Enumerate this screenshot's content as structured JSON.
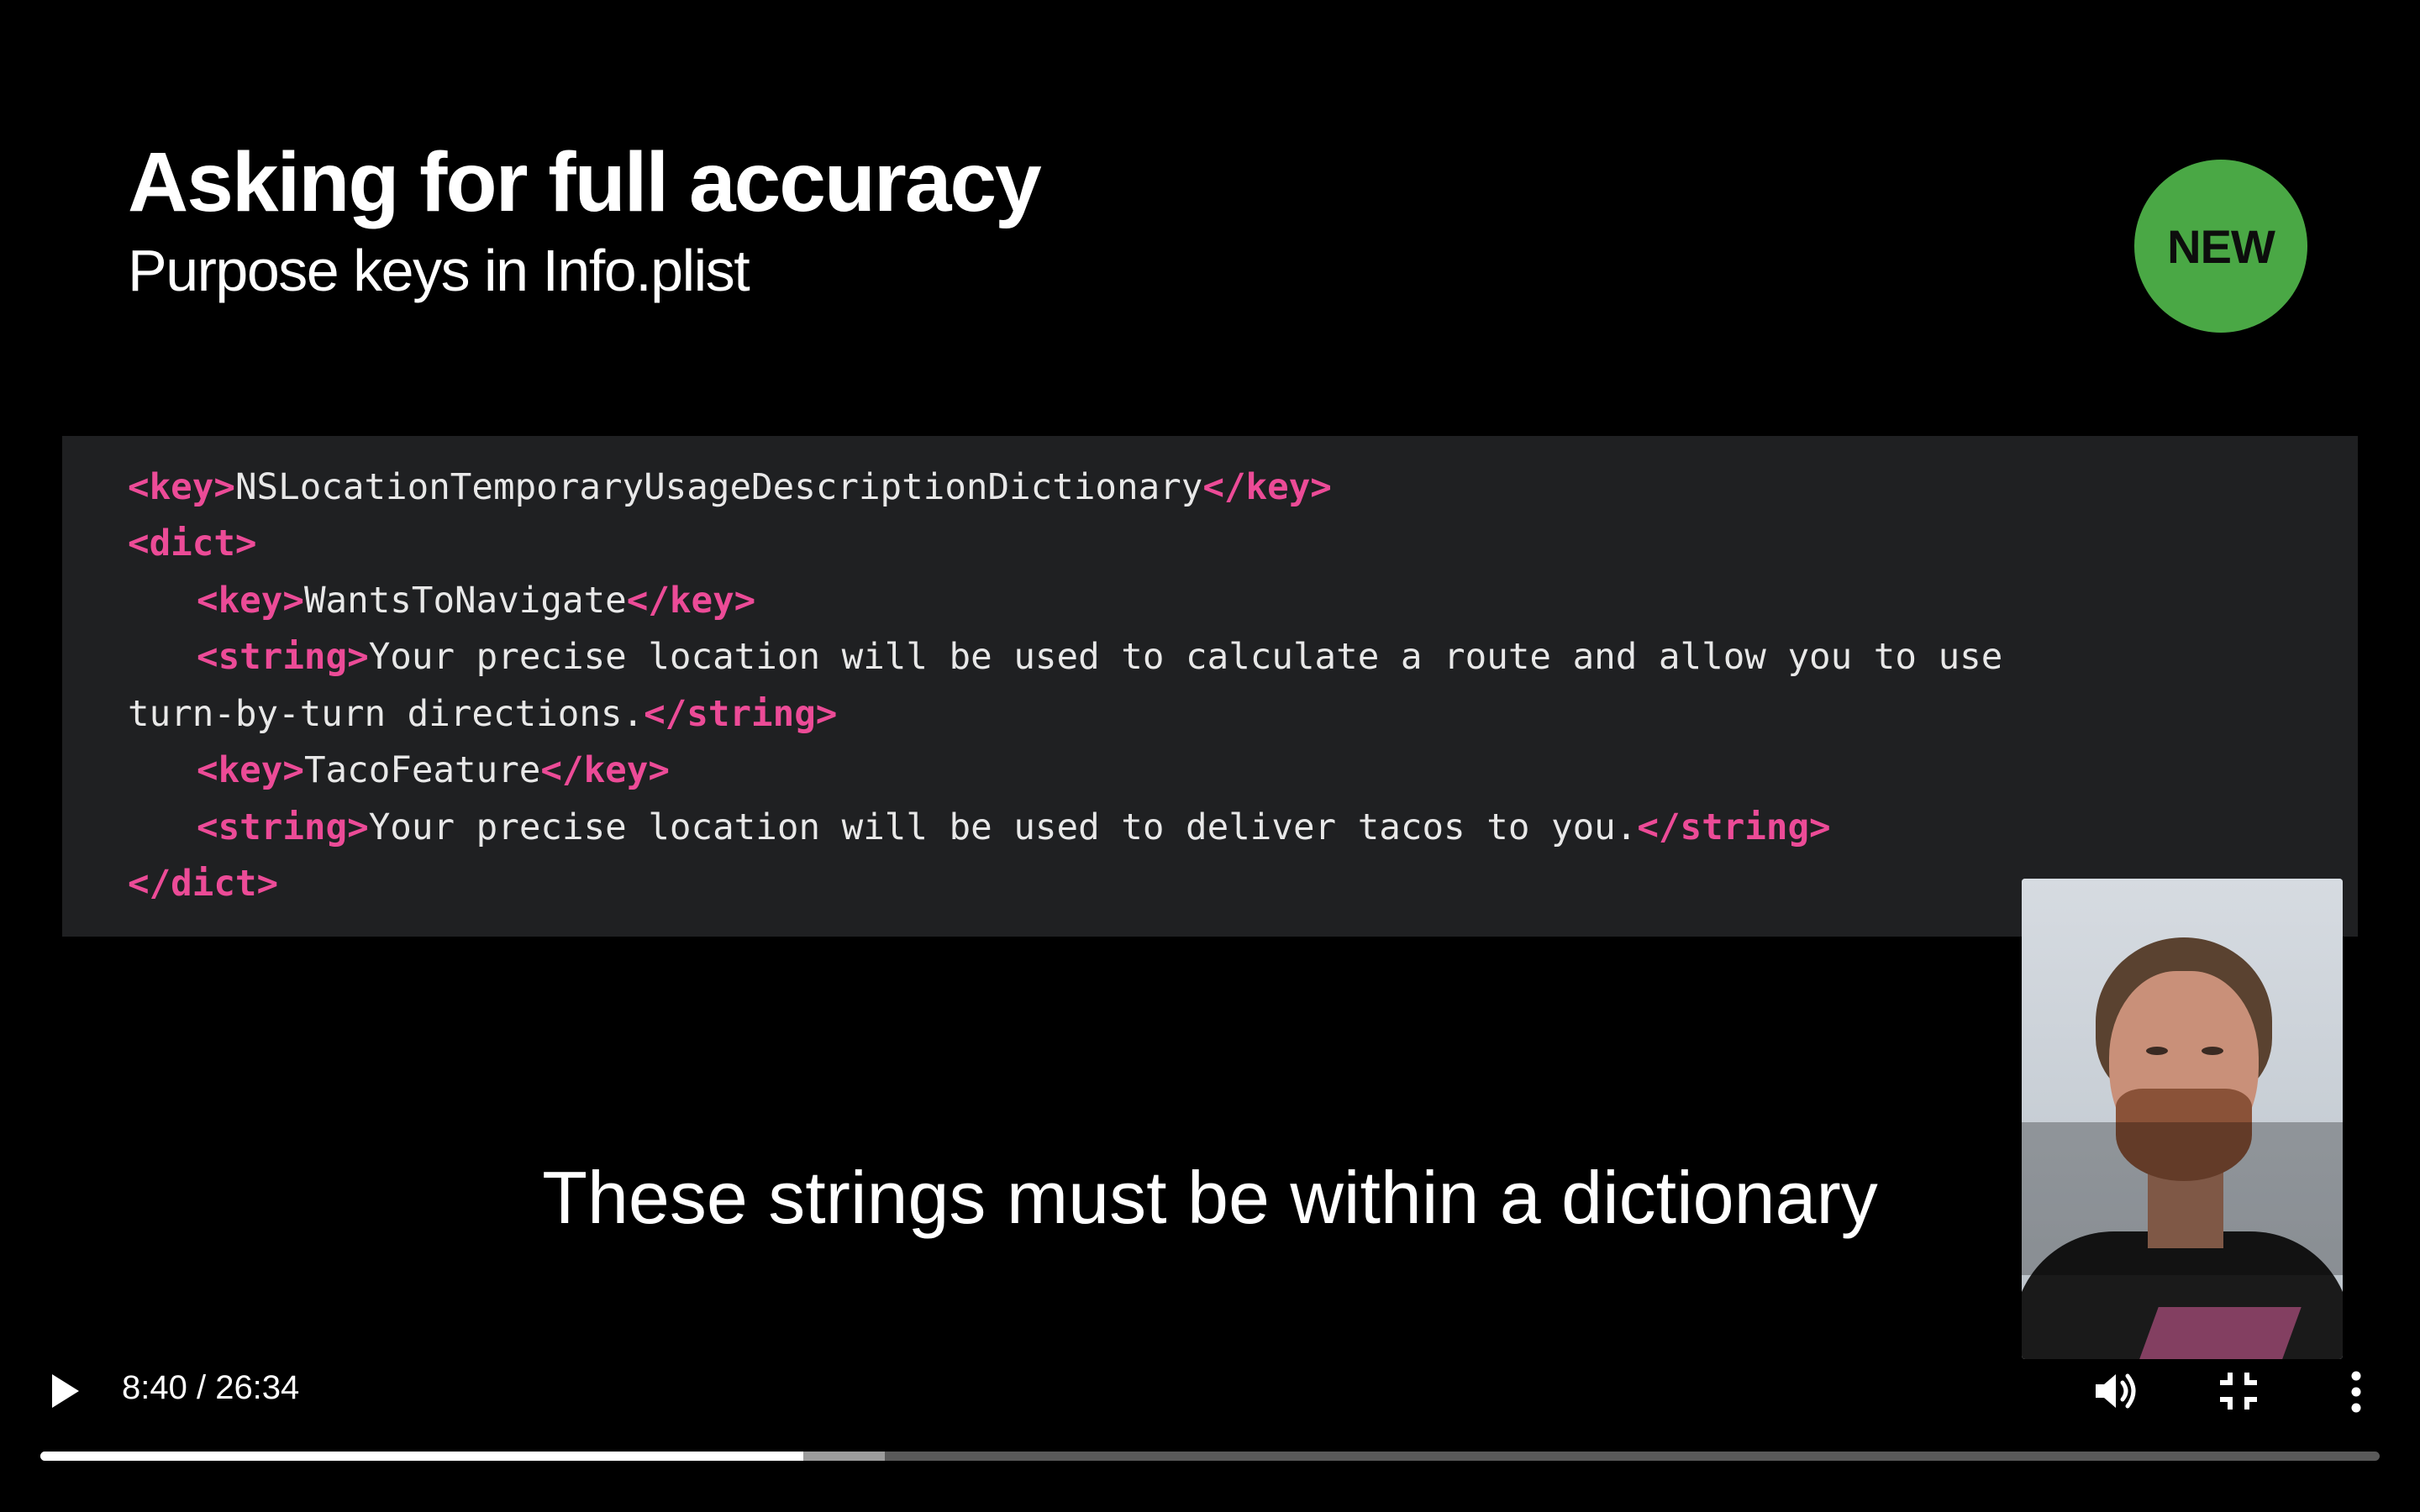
{
  "slide": {
    "title": "Asking for full accuracy",
    "subtitle": "Purpose keys in Info.plist",
    "badge": "NEW"
  },
  "code": {
    "line1": {
      "open": "<key>",
      "text": "NSLocationTemporaryUsageDescriptionDictionary",
      "close": "</key>"
    },
    "line2": {
      "tag": "<dict>"
    },
    "line3": {
      "open": "<key>",
      "text": "WantsToNavigate",
      "close": "</key>"
    },
    "line4": {
      "open": "<string>",
      "text": "Your precise location will be used to calculate a route and allow you to use"
    },
    "line5": {
      "text": "turn-by-turn directions.",
      "close": "</string>"
    },
    "line6": {
      "open": "<key>",
      "text": "TacoFeature",
      "close": "</key>"
    },
    "line7": {
      "open": "<string>",
      "text": "Your precise location will be used to deliver tacos to you.",
      "close": "</string>"
    },
    "line8": {
      "tag": "</dict>"
    }
  },
  "caption": "These strings must be within a dictionary",
  "player": {
    "time": "8:40 / 26:34",
    "progress_fraction": 0.326,
    "buffered_fraction": 0.361,
    "icons": [
      "play-icon",
      "volume-icon",
      "exit-fullscreen-icon",
      "more-options-icon"
    ]
  },
  "colors": {
    "badge": "#4aa845",
    "code_tag": "#ec4b97",
    "code_text": "#e8e8e8",
    "code_background": "#1f2022"
  }
}
